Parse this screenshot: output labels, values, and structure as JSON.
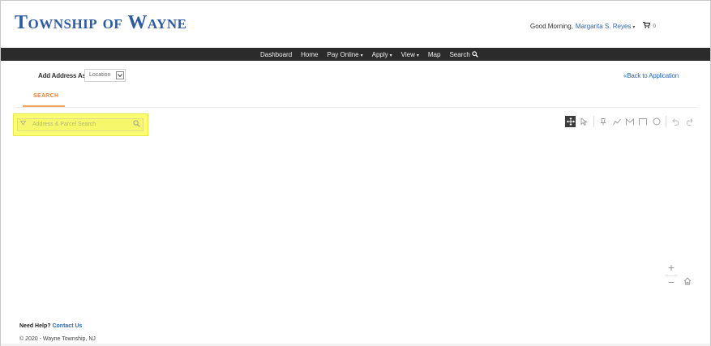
{
  "header": {
    "logo": "Township of Wayne",
    "greeting": "Good Morning,",
    "user_name": "Margarita S. Reyes",
    "user_caret": "▾",
    "cart_icon": "cart-icon",
    "cart_count": "0"
  },
  "nav": {
    "items": [
      {
        "label": "Dashboard",
        "arrow": ""
      },
      {
        "label": "Home",
        "arrow": ""
      },
      {
        "label": "Pay Online",
        "arrow": "▾"
      },
      {
        "label": "Apply",
        "arrow": "▾"
      },
      {
        "label": "View",
        "arrow": "▾"
      },
      {
        "label": "Map",
        "arrow": ""
      },
      {
        "label": "Search",
        "arrow": ""
      }
    ]
  },
  "toolbar": {
    "add_address_label": "Add Address As",
    "address_type_value": "Location",
    "back_link": "«Back to Application"
  },
  "tabs": [
    {
      "label": "SEARCH"
    }
  ],
  "search": {
    "placeholder": "Address & Parcel Search",
    "highlight_color": "#fdfd72"
  },
  "map": {
    "tools": [
      "pan-icon",
      "select-icon",
      "point-icon",
      "line-icon",
      "measure-icon",
      "rectangle-icon",
      "circle-icon",
      "undo-icon",
      "redo-icon"
    ],
    "zoom_in": "+",
    "zoom_out": "−",
    "home": "⌂"
  },
  "footer": {
    "help_label": "Need Help?",
    "help_link": "Contact Us",
    "copyright": "© 2020 - Wayne Township, NJ"
  },
  "colors": {
    "brand_blue": "#2e5aa0",
    "nav_bg": "#2b2b2b",
    "link": "#2a6bb6",
    "tab_accent": "#e8843b"
  }
}
